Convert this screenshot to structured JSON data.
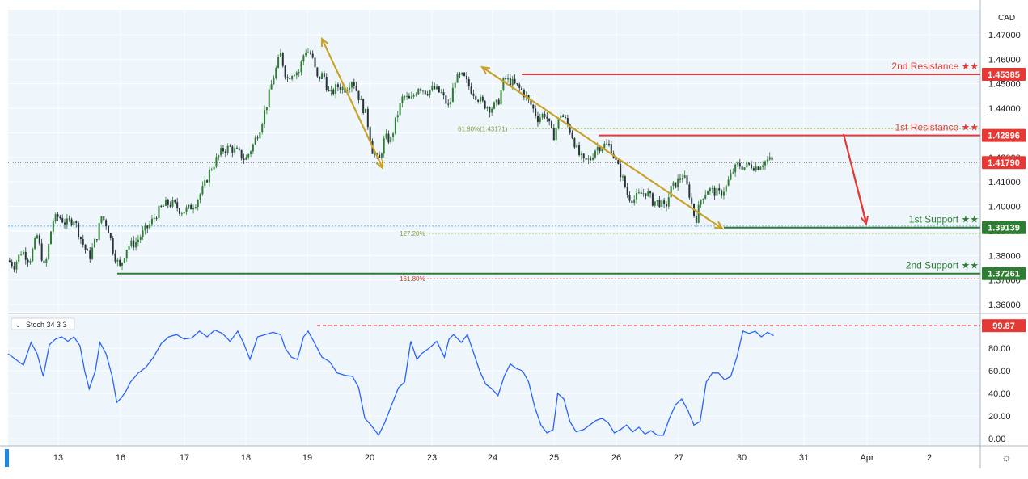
{
  "colors": {
    "background": "#eef6fc",
    "axis_background": "#ffffff",
    "grid": "#ffffff",
    "candle_up": "#2e7d32",
    "candle_down": "#263238",
    "resistance": "#e53935",
    "support": "#2e7d32",
    "arrow": "#c9a227",
    "stoch_line": "#2962ff",
    "text": "#222222",
    "price_dotted": "#555555",
    "fib_green": "#9ccc65",
    "fib_red": "#e57373",
    "axis_line": "#b0b8bf"
  },
  "axis": {
    "currency": "CAD",
    "x_tick_labels": [
      "13",
      "16",
      "17",
      "18",
      "19",
      "20",
      "23",
      "24",
      "25",
      "26",
      "27",
      "30",
      "31",
      "Apr",
      "2"
    ],
    "stoch_tick_labels": [
      "0.00",
      "20.00",
      "40.00",
      "60.00",
      "80.00"
    ]
  },
  "levels": {
    "r2": {
      "label": "2nd Resistance ★★",
      "value_label": "1.45385"
    },
    "r1": {
      "label": "1st Resistance ★★",
      "value_label": "1.42896"
    },
    "current": {
      "value_label": "1.41790"
    },
    "s1": {
      "label": "1st Support ★★",
      "value_label": "1.39139"
    },
    "s2": {
      "label": "2nd Support ★★",
      "value_label": "1.37261"
    }
  },
  "fib_labels": {
    "f618": "61.80%(1.43171)",
    "f1272": "127.20%",
    "f1618": "161.80%"
  },
  "stoch": {
    "title": "Stoch 34 3 3",
    "level_label": "99.87"
  },
  "chart_data": [
    {
      "type": "candlestick",
      "title": "",
      "ylabel": "CAD",
      "ylim": [
        1.355,
        1.4742
      ],
      "y_ticks": [
        1.36,
        1.37,
        1.38,
        1.39,
        1.4,
        1.41,
        1.42,
        1.43,
        1.44,
        1.45,
        1.46,
        1.47
      ],
      "x_ticks": [
        "13",
        "16",
        "17",
        "18",
        "19",
        "20",
        "23",
        "24",
        "25",
        "26",
        "27",
        "30",
        "31",
        "Apr",
        "2"
      ],
      "horizontal_levels": [
        {
          "name": "2nd Resistance",
          "value": 1.45385
        },
        {
          "name": "1st Resistance",
          "value": 1.42896
        },
        {
          "name": "1st Support",
          "value": 1.39139
        },
        {
          "name": "2nd Support",
          "value": 1.37261
        },
        {
          "name": "current price",
          "value": 1.4179
        }
      ],
      "fibonacci": [
        {
          "label": "61.80%",
          "value": 1.43171
        },
        {
          "label": "127.20%",
          "value": 1.389
        },
        {
          "label": "161.80%",
          "value": 1.3705
        }
      ],
      "price_path": [
        [
          0,
          1.378
        ],
        [
          8,
          1.376
        ],
        [
          18,
          1.382
        ],
        [
          28,
          1.378
        ],
        [
          38,
          1.388
        ],
        [
          48,
          1.374
        ],
        [
          58,
          1.394
        ],
        [
          66,
          1.396
        ],
        [
          76,
          1.393
        ],
        [
          86,
          1.395
        ],
        [
          96,
          1.386
        ],
        [
          106,
          1.379
        ],
        [
          116,
          1.388
        ],
        [
          122,
          1.396
        ],
        [
          130,
          1.392
        ],
        [
          138,
          1.381
        ],
        [
          146,
          1.375
        ],
        [
          156,
          1.384
        ],
        [
          166,
          1.385
        ],
        [
          176,
          1.389
        ],
        [
          186,
          1.393
        ],
        [
          196,
          1.398
        ],
        [
          206,
          1.401
        ],
        [
          216,
          1.401
        ],
        [
          226,
          1.398
        ],
        [
          236,
          1.399
        ],
        [
          246,
          1.402
        ],
        [
          256,
          1.408
        ],
        [
          264,
          1.415
        ],
        [
          272,
          1.419
        ],
        [
          280,
          1.423
        ],
        [
          290,
          1.424
        ],
        [
          300,
          1.422
        ],
        [
          310,
          1.419
        ],
        [
          320,
          1.425
        ],
        [
          330,
          1.433
        ],
        [
          338,
          1.442
        ],
        [
          346,
          1.452
        ],
        [
          356,
          1.462
        ],
        [
          364,
          1.452
        ],
        [
          372,
          1.455
        ],
        [
          380,
          1.455
        ],
        [
          388,
          1.464
        ],
        [
          396,
          1.462
        ],
        [
          404,
          1.452
        ],
        [
          412,
          1.454
        ],
        [
          420,
          1.445
        ],
        [
          430,
          1.449
        ],
        [
          440,
          1.448
        ],
        [
          450,
          1.452
        ],
        [
          460,
          1.443
        ],
        [
          468,
          1.437
        ],
        [
          476,
          1.423
        ],
        [
          484,
          1.418
        ],
        [
          492,
          1.428
        ],
        [
          500,
          1.427
        ],
        [
          508,
          1.437
        ],
        [
          516,
          1.445
        ],
        [
          526,
          1.443
        ],
        [
          536,
          1.449
        ],
        [
          546,
          1.447
        ],
        [
          556,
          1.448
        ],
        [
          566,
          1.446
        ],
        [
          576,
          1.44
        ],
        [
          584,
          1.452
        ],
        [
          594,
          1.453
        ],
        [
          604,
          1.448
        ],
        [
          612,
          1.445
        ],
        [
          620,
          1.442
        ],
        [
          630,
          1.44
        ],
        [
          640,
          1.442
        ],
        [
          648,
          1.452
        ],
        [
          656,
          1.451
        ],
        [
          664,
          1.449
        ],
        [
          672,
          1.447
        ],
        [
          682,
          1.442
        ],
        [
          692,
          1.436
        ],
        [
          702,
          1.438
        ],
        [
          712,
          1.428
        ],
        [
          722,
          1.438
        ],
        [
          730,
          1.434
        ],
        [
          738,
          1.428
        ],
        [
          744,
          1.422
        ],
        [
          752,
          1.418
        ],
        [
          760,
          1.419
        ],
        [
          768,
          1.424
        ],
        [
          778,
          1.425
        ],
        [
          786,
          1.425
        ],
        [
          794,
          1.418
        ],
        [
          802,
          1.412
        ],
        [
          810,
          1.404
        ],
        [
          818,
          1.403
        ],
        [
          826,
          1.405
        ],
        [
          834,
          1.406
        ],
        [
          842,
          1.402
        ],
        [
          850,
          1.402
        ],
        [
          858,
          1.399
        ],
        [
          866,
          1.407
        ],
        [
          874,
          1.41
        ],
        [
          882,
          1.413
        ],
        [
          890,
          1.405
        ],
        [
          898,
          1.394
        ],
        [
          906,
          1.404
        ],
        [
          914,
          1.407
        ],
        [
          922,
          1.406
        ],
        [
          930,
          1.405
        ],
        [
          938,
          1.408
        ],
        [
          946,
          1.414
        ],
        [
          954,
          1.417
        ],
        [
          962,
          1.416
        ],
        [
          970,
          1.417
        ],
        [
          978,
          1.416
        ],
        [
          986,
          1.418
        ],
        [
          994,
          1.419
        ],
        [
          1000,
          1.4179
        ]
      ]
    },
    {
      "type": "line",
      "title": "Stoch 34 3 3",
      "ylim": [
        0,
        100
      ],
      "y_ticks": [
        0,
        20,
        40,
        60,
        80
      ],
      "series": [
        {
          "values": [
            [
              0,
              75
            ],
            [
              10,
              70
            ],
            [
              20,
              65
            ],
            [
              30,
              85
            ],
            [
              38,
              75
            ],
            [
              46,
              55
            ],
            [
              54,
              83
            ],
            [
              62,
              88
            ],
            [
              70,
              90
            ],
            [
              78,
              86
            ],
            [
              86,
              90
            ],
            [
              94,
              82
            ],
            [
              100,
              60
            ],
            [
              106,
              44
            ],
            [
              114,
              60
            ],
            [
              120,
              85
            ],
            [
              128,
              75
            ],
            [
              136,
              55
            ],
            [
              142,
              32
            ],
            [
              148,
              36
            ],
            [
              154,
              42
            ],
            [
              160,
              50
            ],
            [
              170,
              58
            ],
            [
              180,
              63
            ],
            [
              190,
              72
            ],
            [
              200,
              84
            ],
            [
              210,
              90
            ],
            [
              220,
              92
            ],
            [
              230,
              88
            ],
            [
              240,
              89
            ],
            [
              250,
              95
            ],
            [
              260,
              90
            ],
            [
              270,
              96
            ],
            [
              280,
              93
            ],
            [
              290,
              86
            ],
            [
              300,
              95
            ],
            [
              308,
              84
            ],
            [
              316,
              70
            ],
            [
              326,
              90
            ],
            [
              336,
              92
            ],
            [
              346,
              94
            ],
            [
              356,
              92
            ],
            [
              362,
              80
            ],
            [
              370,
              72
            ],
            [
              378,
              70
            ],
            [
              386,
              90
            ],
            [
              392,
              95
            ],
            [
              400,
              85
            ],
            [
              410,
              72
            ],
            [
              420,
              68
            ],
            [
              430,
              58
            ],
            [
              440,
              56
            ],
            [
              450,
              55
            ],
            [
              458,
              45
            ],
            [
              466,
              18
            ],
            [
              474,
              12
            ],
            [
              484,
              3
            ],
            [
              492,
              14
            ],
            [
              500,
              28
            ],
            [
              510,
              45
            ],
            [
              518,
              50
            ],
            [
              526,
              86
            ],
            [
              534,
              70
            ],
            [
              540,
              75
            ],
            [
              550,
              80
            ],
            [
              560,
              86
            ],
            [
              570,
              72
            ],
            [
              576,
              88
            ],
            [
              582,
              92
            ],
            [
              592,
              85
            ],
            [
              600,
              92
            ],
            [
              608,
              76
            ],
            [
              616,
              60
            ],
            [
              624,
              48
            ],
            [
              632,
              44
            ],
            [
              640,
              38
            ],
            [
              648,
              55
            ],
            [
              656,
              66
            ],
            [
              664,
              62
            ],
            [
              672,
              60
            ],
            [
              680,
              50
            ],
            [
              688,
              28
            ],
            [
              696,
              12
            ],
            [
              704,
              5
            ],
            [
              712,
              8
            ],
            [
              718,
              40
            ],
            [
              726,
              35
            ],
            [
              734,
              15
            ],
            [
              742,
              6
            ],
            [
              752,
              8
            ],
            [
              760,
              12
            ],
            [
              768,
              16
            ],
            [
              776,
              18
            ],
            [
              784,
              14
            ],
            [
              792,
              5
            ],
            [
              800,
              8
            ],
            [
              808,
              12
            ],
            [
              816,
              6
            ],
            [
              824,
              10
            ],
            [
              832,
              4
            ],
            [
              840,
              7
            ],
            [
              848,
              3
            ],
            [
              856,
              3
            ],
            [
              864,
              18
            ],
            [
              872,
              30
            ],
            [
              880,
              35
            ],
            [
              888,
              25
            ],
            [
              896,
              12
            ],
            [
              904,
              15
            ],
            [
              912,
              50
            ],
            [
              920,
              58
            ],
            [
              928,
              58
            ],
            [
              936,
              52
            ],
            [
              944,
              55
            ],
            [
              952,
              72
            ],
            [
              960,
              95
            ],
            [
              968,
              93
            ],
            [
              976,
              95
            ],
            [
              984,
              90
            ],
            [
              992,
              94
            ],
            [
              1000,
              91
            ]
          ]
        }
      ],
      "level": 99.87
    }
  ]
}
